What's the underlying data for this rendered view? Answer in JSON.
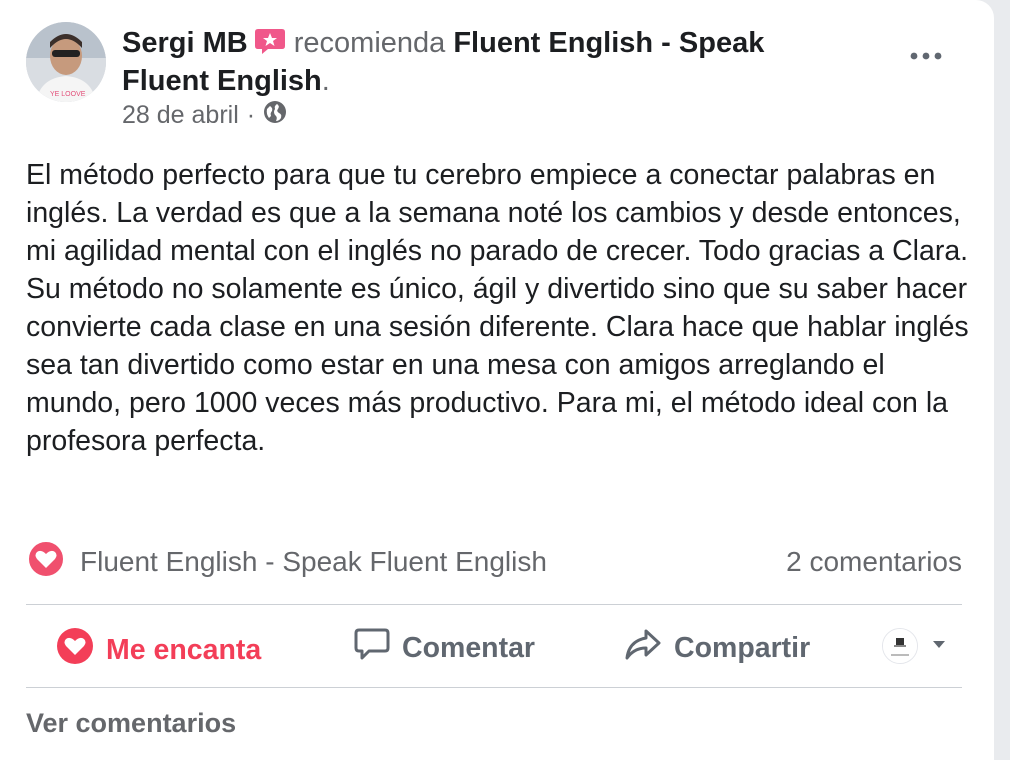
{
  "post": {
    "author": "Sergi MB",
    "action_text": "recomienda",
    "page_link": "Fluent English - Speak Fluent English",
    "period": ".",
    "date": "28 de abril",
    "separator": "·",
    "audience_icon": "globe-icon",
    "text": "El método perfecto para que tu cerebro empiece a conectar palabras en inglés. La verdad es que a la semana noté los cambios y desde entonces, mi agilidad mental con el inglés no parado de crecer. Todo gracias a Clara. Su método no solamente es único, ágil y divertido sino que su saber hacer convierte cada clase en una sesión diferente. Clara hace que hablar inglés sea tan divertido como estar en una mesa con amigos arreglando el mundo, pero 1000 veces más productivo. Para mi, el método ideal con la profesora perfecta."
  },
  "summary": {
    "reaction_icon": "love-reaction-icon",
    "reactor": "Fluent English - Speak Fluent English",
    "comments_count": "2 comentarios"
  },
  "actions": {
    "love": "Me encanta",
    "comment": "Comentar",
    "share": "Compartir"
  },
  "footer": {
    "view_comments": "Ver comentarios"
  },
  "colors": {
    "love_red": "#f33e58",
    "text_muted": "#65676b",
    "divider": "#ccd0d5"
  }
}
